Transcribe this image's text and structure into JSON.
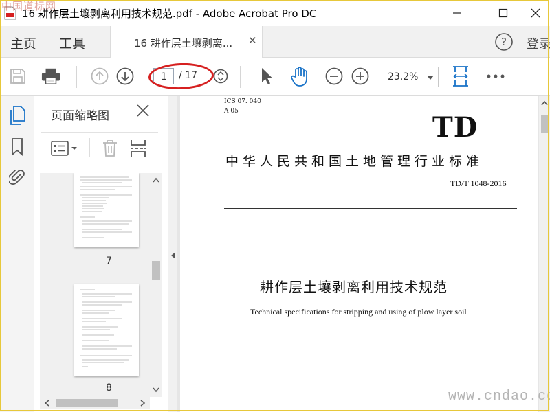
{
  "window": {
    "title": "16 耕作层土壤剥离利用技术规范.pdf - Adobe Acrobat Pro DC",
    "watermark_top": "中国道标网"
  },
  "menu": {
    "home_label": "主页",
    "tools_label": "工具",
    "tab_label": "16 耕作层土壤剥离...",
    "login_label": "登录"
  },
  "toolbar": {
    "current_page": "1",
    "total_pages": "/ 17",
    "zoom": "23.2%"
  },
  "thumbnails": {
    "panel_title": "页面缩略图",
    "pages": [
      {
        "label": "7"
      },
      {
        "label": "8"
      }
    ]
  },
  "document": {
    "ics": "ICS   07. 040",
    "a_class": "A  05",
    "standard_code": "TD",
    "organization": "中华人民共和国土地管理行业标准",
    "standard_number": "TD/T 1048-2016",
    "title_cn": "耕作层土壤剥离利用技术规范",
    "title_en": "Technical specifications for stripping and using of plow layer soil"
  },
  "watermark_bottom": "www.cndao.com",
  "colors": {
    "accent_blue": "#1a73c8",
    "annotation_red": "#d62020",
    "icon_gray": "#555555",
    "disabled_gray": "#b8b8b8"
  }
}
